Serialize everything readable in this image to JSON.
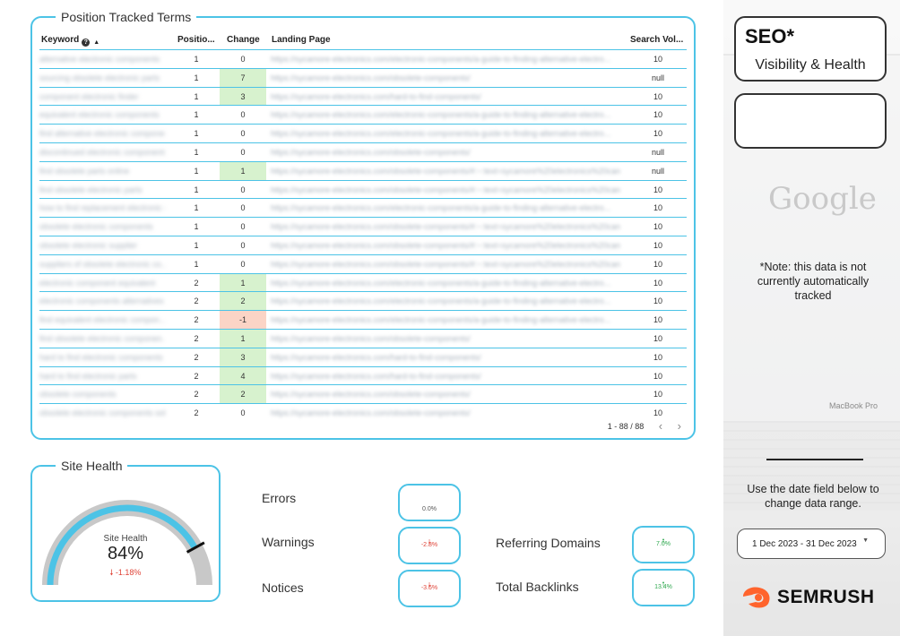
{
  "position_tracked": {
    "title": "Position Tracked Terms",
    "headers": {
      "keyword": "Keyword",
      "position": "Positio...",
      "change": "Change",
      "landing": "Landing Page",
      "volume": "Search Vol..."
    },
    "rows": [
      {
        "kw": "alternative electronic components",
        "pos": "1",
        "chg": "0",
        "lp": "https://sycamore-electronics.com/electronic-components/a-guide-to-finding-alternative-electro...",
        "sv": "10",
        "style": "none"
      },
      {
        "kw": "sourcing obsolete electronic parts",
        "pos": "1",
        "chg": "7",
        "lp": "https://sycamore-electronics.com/obsolete-components/",
        "sv": "null",
        "style": "pos"
      },
      {
        "kw": "component electronic finder",
        "pos": "1",
        "chg": "3",
        "lp": "https://sycamore-electronics.com/hard-to-find-components/",
        "sv": "10",
        "style": "pos"
      },
      {
        "kw": "equivalent electronic components",
        "pos": "1",
        "chg": "0",
        "lp": "https://sycamore-electronics.com/electronic-components/a-guide-to-finding-alternative-electro...",
        "sv": "10",
        "style": "none"
      },
      {
        "kw": "find alternative electronic components",
        "pos": "1",
        "chg": "0",
        "lp": "https://sycamore-electronics.com/electronic-components/a-guide-to-finding-alternative-electro...",
        "sv": "10",
        "style": "none"
      },
      {
        "kw": "discontinued electronic components",
        "pos": "1",
        "chg": "0",
        "lp": "https://sycamore-electronics.com/obsolete-components/",
        "sv": "null",
        "style": "none"
      },
      {
        "kw": "find obsolete parts online",
        "pos": "1",
        "chg": "1",
        "lp": "https://sycamore-electronics.com/obsolete-components/#:~:text=sycamore%20electronics%20can...",
        "sv": "null",
        "style": "pos"
      },
      {
        "kw": "find obsolete electronic parts",
        "pos": "1",
        "chg": "0",
        "lp": "https://sycamore-electronics.com/obsolete-components/#:~:text=sycamore%20electronics%20can...",
        "sv": "10",
        "style": "none"
      },
      {
        "kw": "how to find replacement electronic c...",
        "pos": "1",
        "chg": "0",
        "lp": "https://sycamore-electronics.com/electronic-components/a-guide-to-finding-alternative-electro...",
        "sv": "10",
        "style": "none"
      },
      {
        "kw": "obsolete electronic components",
        "pos": "1",
        "chg": "0",
        "lp": "https://sycamore-electronics.com/obsolete-components/#:~:text=sycamore%20electronics%20can...",
        "sv": "10",
        "style": "none"
      },
      {
        "kw": "obsolete electronic supplier",
        "pos": "1",
        "chg": "0",
        "lp": "https://sycamore-electronics.com/obsolete-components/#:~:text=sycamore%20electronics%20can...",
        "sv": "10",
        "style": "none"
      },
      {
        "kw": "suppliers of obsolete electronic co...",
        "pos": "1",
        "chg": "0",
        "lp": "https://sycamore-electronics.com/obsolete-components/#:~:text=sycamore%20electronics%20can...",
        "sv": "10",
        "style": "none"
      },
      {
        "kw": "electronic component equivalent",
        "pos": "2",
        "chg": "1",
        "lp": "https://sycamore-electronics.com/electronic-components/a-guide-to-finding-alternative-electro...",
        "sv": "10",
        "style": "pos"
      },
      {
        "kw": "electronic components alternatives",
        "pos": "2",
        "chg": "2",
        "lp": "https://sycamore-electronics.com/electronic-components/a-guide-to-finding-alternative-electro...",
        "sv": "10",
        "style": "pos"
      },
      {
        "kw": "find equivalent electronic compon...",
        "pos": "2",
        "chg": "-1",
        "lp": "https://sycamore-electronics.com/electronic-components/a-guide-to-finding-alternative-electro...",
        "sv": "10",
        "style": "neg"
      },
      {
        "kw": "find obsolete electronic componen...",
        "pos": "2",
        "chg": "1",
        "lp": "https://sycamore-electronics.com/obsolete-components/",
        "sv": "10",
        "style": "pos"
      },
      {
        "kw": "hard to find electronic components",
        "pos": "2",
        "chg": "3",
        "lp": "https://sycamore-electronics.com/hard-to-find-components/",
        "sv": "10",
        "style": "pos"
      },
      {
        "kw": "hard to find electronic parts",
        "pos": "2",
        "chg": "4",
        "lp": "https://sycamore-electronics.com/hard-to-find-components/",
        "sv": "10",
        "style": "pos"
      },
      {
        "kw": "obsolete components",
        "pos": "2",
        "chg": "2",
        "lp": "https://sycamore-electronics.com/obsolete-components/",
        "sv": "10",
        "style": "pos"
      },
      {
        "kw": "obsolete electronic components sol...",
        "pos": "2",
        "chg": "0",
        "lp": "https://sycamore-electronics.com/obsolete-components/",
        "sv": "10",
        "style": "none"
      }
    ],
    "pager": "1 - 88 / 88"
  },
  "site_health": {
    "title": "Site Health",
    "gauge_label": "Site Health",
    "value": "84%",
    "value_fraction": 0.84,
    "delta": "-1.18%",
    "colors": {
      "track": "#c8c8c8",
      "fill": "#4cc3e6",
      "marker": "#111111"
    }
  },
  "metrics": {
    "errors": {
      "label": "Errors",
      "delta": "0.0%"
    },
    "warnings": {
      "label": "Warnings",
      "delta": "-2.8%"
    },
    "notices": {
      "label": "Notices",
      "delta": "-3.6%"
    },
    "referring_domains": {
      "label": "Referring Domains",
      "delta": "7.0%"
    },
    "total_backlinks": {
      "label": "Total Backlinks",
      "delta": "13.4%"
    }
  },
  "sidebar": {
    "title": "SEO*",
    "subtitle": "Visibility & Health",
    "google_word": "Google",
    "note": "*Note: this data is not currently automatically tracked",
    "mac_label": "MacBook Pro",
    "date_help": "Use the date field below to change data range.",
    "date_range": "1 Dec 2023 - 31 Dec 2023",
    "brand": "SEMRUSH",
    "brand_color": "#ff642d"
  },
  "accent_color": "#4cc3e6"
}
